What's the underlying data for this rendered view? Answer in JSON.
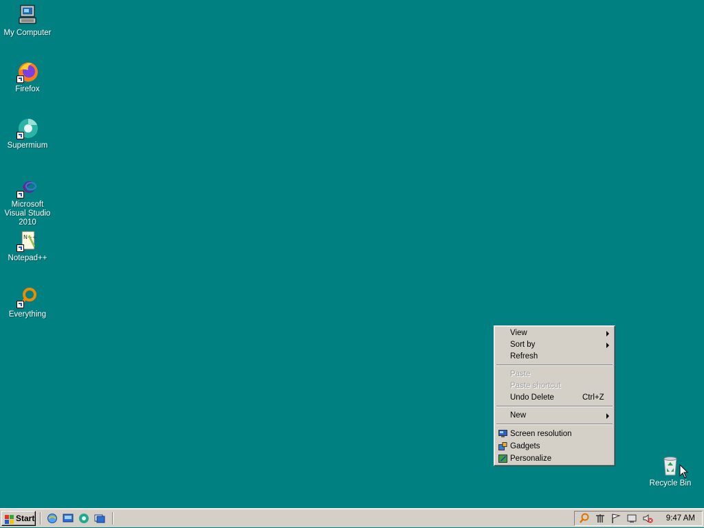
{
  "desktop": {
    "background": "#008080",
    "icons": [
      {
        "label": "My Computer",
        "icon": "my-computer-icon"
      },
      {
        "label": "Firefox",
        "icon": "firefox-icon"
      },
      {
        "label": "Supermium",
        "icon": "supermium-icon"
      },
      {
        "label": "Microsoft Visual Studio 2010",
        "icon": "visual-studio-icon"
      },
      {
        "label": "Notepad++",
        "icon": "notepad-plus-plus-icon"
      },
      {
        "label": "Everything",
        "icon": "everything-search-icon"
      },
      {
        "label": "Recycle Bin",
        "icon": "recycle-bin-icon"
      }
    ]
  },
  "context_menu": {
    "items": [
      {
        "label": "View",
        "submenu": true,
        "enabled": true
      },
      {
        "label": "Sort by",
        "submenu": true,
        "enabled": true
      },
      {
        "label": "Refresh",
        "enabled": true
      },
      {
        "label": "Paste",
        "enabled": false
      },
      {
        "label": "Paste shortcut",
        "enabled": false
      },
      {
        "label": "Undo Delete",
        "shortcut": "Ctrl+Z",
        "enabled": true
      },
      {
        "label": "New",
        "submenu": true,
        "enabled": true
      },
      {
        "label": "Screen resolution",
        "icon": "screen-resolution-icon",
        "enabled": true
      },
      {
        "label": "Gadgets",
        "icon": "gadgets-icon",
        "enabled": true
      },
      {
        "label": "Personalize",
        "icon": "personalize-icon",
        "enabled": true
      }
    ]
  },
  "taskbar": {
    "start_label": "Start",
    "quick_launch": [
      "internet-explorer-icon",
      "show-desktop-icon",
      "browser-icon",
      "window-switch-icon"
    ],
    "tray_icons": [
      "search-icon",
      "network-icon",
      "action-center-flag-icon",
      "power-icon",
      "volume-muted-icon"
    ],
    "clock": "9:47 AM"
  }
}
